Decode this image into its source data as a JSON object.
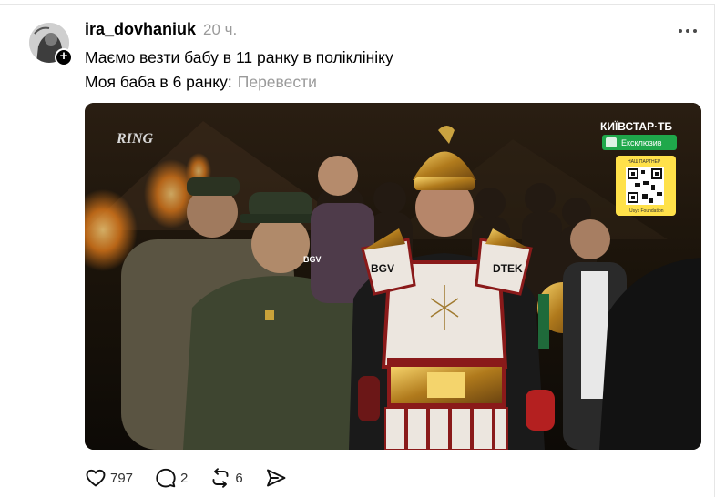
{
  "post": {
    "username": "ira_dovhaniuk",
    "time": "20 ч.",
    "text_line1": "Маємо везти бабу в 11 ранку в поліклініку",
    "text_line2": "Моя баба в 6 ранку:",
    "translate_label": "Перевести"
  },
  "media": {
    "ring_logo": "RING",
    "broadcaster": "КИЇВСТАР·ТБ",
    "exclusive_badge": "Ексклюзив",
    "qr_caption_top": "НАШ ПАРТНЕР",
    "qr_caption_bottom": "Usyk Foundation",
    "sponsor_bgv_small": "BGV",
    "sponsor_bgv": "BGV",
    "sponsor_dtek": "DTEK"
  },
  "actions": {
    "likes": "797",
    "comments": "2",
    "reposts": "6"
  },
  "icons": [
    "avatar-image",
    "follow-plus-icon",
    "more-icon",
    "heart-icon",
    "comment-icon",
    "repost-icon",
    "share-icon",
    "qr-code-icon"
  ]
}
